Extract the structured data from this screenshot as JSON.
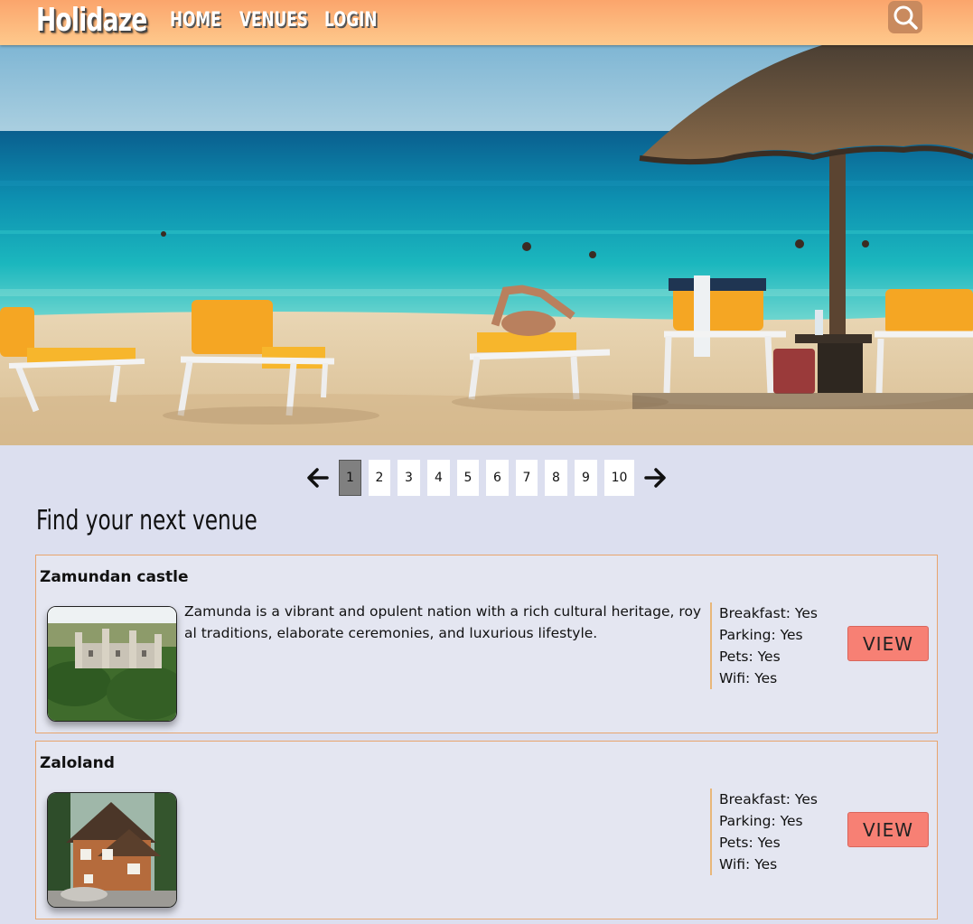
{
  "header": {
    "logo": "Holidaze",
    "nav": [
      {
        "label": "HOME"
      },
      {
        "label": "VENUES"
      },
      {
        "label": "LOGIN"
      }
    ],
    "search_icon": "search-icon"
  },
  "pagination": {
    "prev_icon": "arrow-left-icon",
    "next_icon": "arrow-right-icon",
    "pages": [
      "1",
      "2",
      "3",
      "4",
      "5",
      "6",
      "7",
      "8",
      "9",
      "10"
    ],
    "current": "1"
  },
  "main": {
    "title": "Find your next venue",
    "venues": [
      {
        "name": "Zamundan castle",
        "description": "Zamunda is a vibrant and opulent nation with a rich cultural heritage, royal traditions, elaborate ceremonies, and luxurious lifestyle.",
        "amenities": [
          "Breakfast: Yes",
          "Parking: Yes",
          "Pets: Yes",
          "Wifi: Yes"
        ],
        "view_label": "VIEW"
      },
      {
        "name": "Zaloland",
        "description": "",
        "amenities": [
          "Breakfast: Yes",
          "Parking: Yes",
          "Pets: Yes",
          "Wifi: Yes"
        ],
        "view_label": "VIEW"
      }
    ]
  },
  "colors": {
    "header_gradient_top": "#fba56c",
    "header_gradient_bottom": "#fec98c",
    "page_background": "#dcdfef",
    "card_border": "#e8a56d",
    "view_button": "#f78074",
    "active_page": "#808080"
  }
}
